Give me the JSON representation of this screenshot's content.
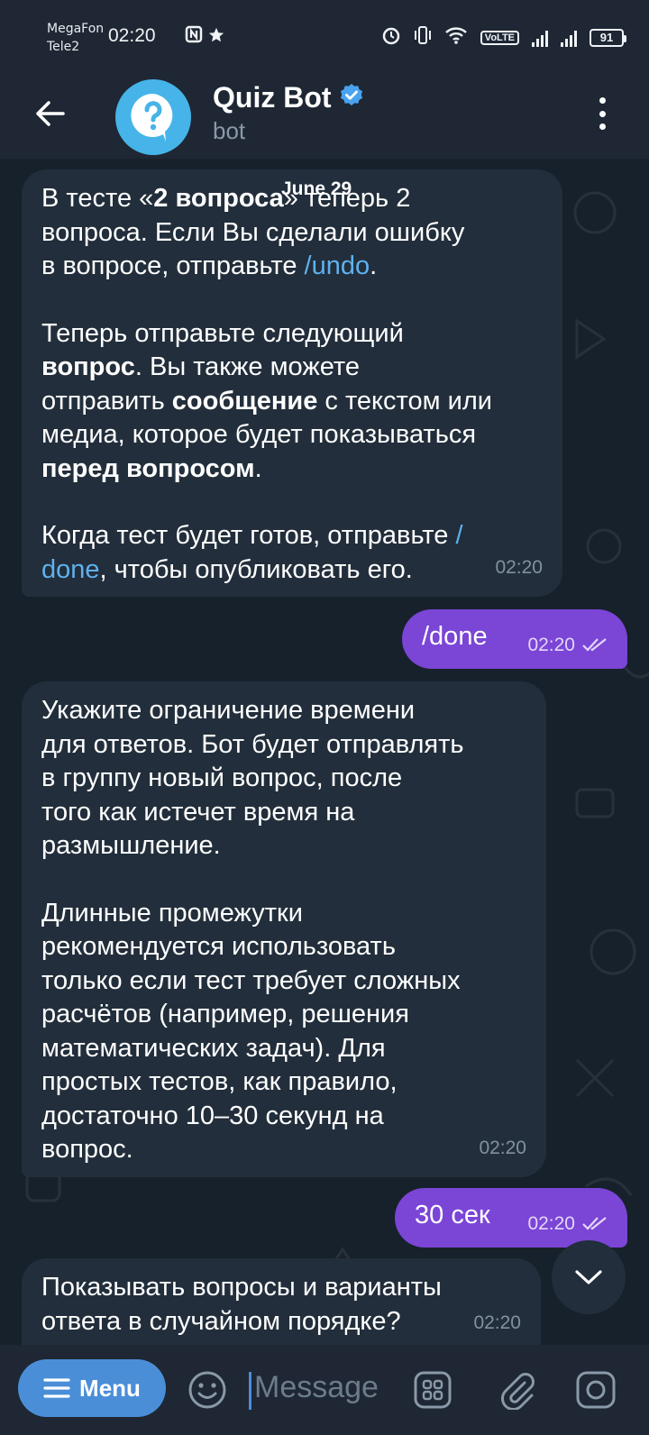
{
  "status_bar": {
    "carrier_1": "MegaFon",
    "carrier_2": "Tele2",
    "time": "02:20",
    "volte": "VoLTE",
    "battery": "91"
  },
  "header": {
    "title": "Quiz Bot",
    "subtitle": "bot"
  },
  "chat": {
    "date_chip": "June 29",
    "messages": [
      {
        "direction": "in",
        "p1_a": "В тесте «",
        "p1_b": "2 вопроса",
        "p1_c": "» теперь 2\nвопроса. Если Вы сделали ошибку\nв вопросе, отправьте ",
        "p1_link": "/undo",
        "p1_d": ".",
        "p2_a": "Теперь отправьте следующий\n",
        "p2_b": "вопрос",
        "p2_c": ". Вы также можете\nотправить ",
        "p2_d": "сообщение",
        "p2_e": " с текстом или\nмедиа, которое будет показываться\n",
        "p2_f": "перед вопросом",
        "p2_g": ".",
        "p3_a": "Когда тест будет готов, отправьте ",
        "p3_link": "/\ndone",
        "p3_b": ", чтобы опубликовать его.",
        "time": "02:20"
      },
      {
        "direction": "out",
        "text": "/done",
        "time": "02:20"
      },
      {
        "direction": "in",
        "p1": "Укажите ограничение времени\nдля ответов. Бот будет отправлять\nв группу новый вопрос, после\nтого как истечет время на\nразмышление.",
        "p2": "Длинные промежутки\nрекомендуется использовать\nтолько если тест требует сложных\nрасчётов (например, решения\nматематических задач). Для\nпростых тестов, как правило,\nдостаточно 10–30 секунд на\nвопрос.",
        "time": "02:20"
      },
      {
        "direction": "out",
        "text": "30 сек",
        "time": "02:20"
      },
      {
        "direction": "in",
        "text": "Показывать вопросы и варианты\nответа в случайном порядке?",
        "time": "02:20"
      }
    ]
  },
  "input_bar": {
    "menu_label": "Menu",
    "placeholder": "Message"
  },
  "colors": {
    "outgoing_bubble": "#7b45d6",
    "incoming_bubble": "#222e3b",
    "link": "#5fb1ee",
    "menu_button": "#4a8ed8",
    "verified_badge": "#4aa3f0"
  },
  "icons": {
    "back": "back-arrow-icon",
    "avatar": "question-mark-icon",
    "verified": "verified-badge-icon",
    "more": "more-vertical-icon",
    "read_status": "double-check-icon",
    "scroll_down": "chevron-down-icon",
    "menu": "hamburger-icon",
    "emoji": "emoji-icon",
    "commands": "commands-grid-icon",
    "attach": "paperclip-icon",
    "camera": "camera-icon"
  }
}
